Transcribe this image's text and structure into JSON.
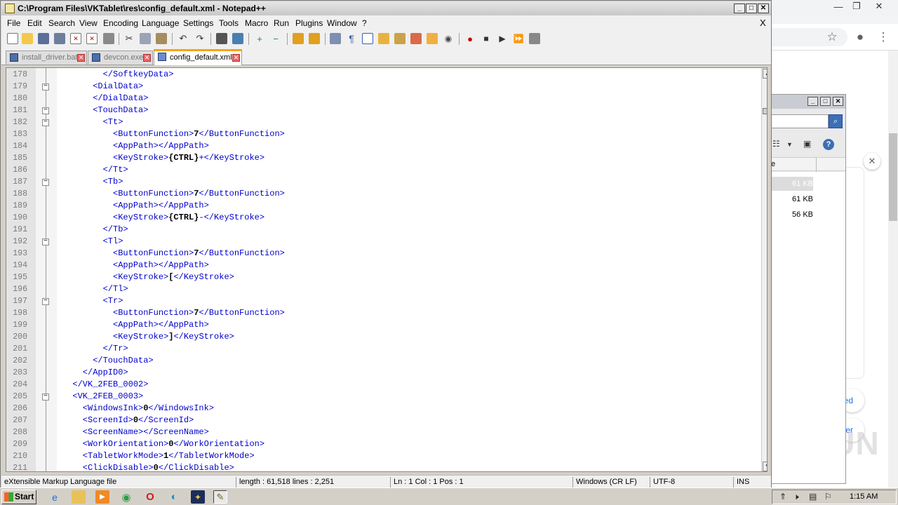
{
  "notepad": {
    "title": "C:\\Program Files\\VKTablet\\res\\config_default.xml - Notepad++",
    "menu": [
      "File",
      "Edit",
      "Search",
      "View",
      "Encoding",
      "Language",
      "Settings",
      "Tools",
      "Macro",
      "Run",
      "Plugins",
      "Window",
      "?"
    ],
    "menu_close": "X",
    "tabs": [
      {
        "label": "install_driver.bat",
        "active": false
      },
      {
        "label": "devcon.exe",
        "active": false
      },
      {
        "label": "config_default.xml",
        "active": true
      }
    ],
    "toolbar_icons": [
      "new-file-icon",
      "open-file-icon",
      "save-icon",
      "save-all-icon",
      "close-icon",
      "close-all-icon",
      "print-icon",
      "cut-icon",
      "copy-icon",
      "paste-icon",
      "undo-icon",
      "redo-icon",
      "find-icon",
      "replace-icon",
      "zoom-in-icon",
      "zoom-out-icon",
      "sync-vertical-icon",
      "sync-horizontal-icon",
      "word-wrap-icon",
      "show-all-chars-icon",
      "indent-guide-icon",
      "udl-icon",
      "doc-map-icon",
      "function-list-icon",
      "folder-workspace-icon",
      "monitor-icon",
      "record-macro-icon",
      "stop-macro-icon",
      "play-macro-icon",
      "run-macro-multiple-icon",
      "save-macro-icon"
    ],
    "lines": [
      {
        "n": "178",
        "fold": "",
        "code": "        </SoftkeyData>"
      },
      {
        "n": "179",
        "fold": "box",
        "code": "      <DialData>"
      },
      {
        "n": "180",
        "fold": "",
        "code": "      </DialData>"
      },
      {
        "n": "181",
        "fold": "box",
        "code": "      <TouchData>"
      },
      {
        "n": "182",
        "fold": "box",
        "code": "        <Tt>"
      },
      {
        "n": "183",
        "fold": "",
        "pre": "          <ButtonFunction>",
        "val": "7",
        "post": "</ButtonFunction>"
      },
      {
        "n": "184",
        "fold": "",
        "code": "          <AppPath></AppPath>"
      },
      {
        "n": "185",
        "fold": "",
        "pre": "          <KeyStroke>",
        "val": "{CTRL}",
        "post": "+</KeyStroke>"
      },
      {
        "n": "186",
        "fold": "",
        "code": "        </Tt>"
      },
      {
        "n": "187",
        "fold": "box",
        "code": "        <Tb>"
      },
      {
        "n": "188",
        "fold": "",
        "pre": "          <ButtonFunction>",
        "val": "7",
        "post": "</ButtonFunction>"
      },
      {
        "n": "189",
        "fold": "",
        "code": "          <AppPath></AppPath>"
      },
      {
        "n": "190",
        "fold": "",
        "pre": "          <KeyStroke>",
        "val": "{CTRL}",
        "post": "-</KeyStroke>"
      },
      {
        "n": "191",
        "fold": "",
        "code": "        </Tb>"
      },
      {
        "n": "192",
        "fold": "box",
        "code": "        <Tl>"
      },
      {
        "n": "193",
        "fold": "",
        "pre": "          <ButtonFunction>",
        "val": "7",
        "post": "</ButtonFunction>"
      },
      {
        "n": "194",
        "fold": "",
        "code": "          <AppPath></AppPath>"
      },
      {
        "n": "195",
        "fold": "",
        "pre": "          <KeyStroke>",
        "val": "[",
        "post": "</KeyStroke>"
      },
      {
        "n": "196",
        "fold": "",
        "code": "        </Tl>"
      },
      {
        "n": "197",
        "fold": "box",
        "code": "        <Tr>"
      },
      {
        "n": "198",
        "fold": "",
        "pre": "          <ButtonFunction>",
        "val": "7",
        "post": "</ButtonFunction>"
      },
      {
        "n": "199",
        "fold": "",
        "code": "          <AppPath></AppPath>"
      },
      {
        "n": "200",
        "fold": "",
        "pre": "          <KeyStroke>",
        "val": "]",
        "post": "</KeyStroke>"
      },
      {
        "n": "201",
        "fold": "",
        "code": "        </Tr>"
      },
      {
        "n": "202",
        "fold": "",
        "code": "      </TouchData>"
      },
      {
        "n": "203",
        "fold": "",
        "code": "    </AppID0>"
      },
      {
        "n": "204",
        "fold": "",
        "code": "  </VK_2FEB_0002>"
      },
      {
        "n": "205",
        "fold": "box",
        "code": "  <VK_2FEB_0003>"
      },
      {
        "n": "206",
        "fold": "",
        "pre": "    <WindowsInk>",
        "val": "0",
        "post": "</WindowsInk>"
      },
      {
        "n": "207",
        "fold": "",
        "pre": "    <ScreenId>",
        "val": "0",
        "post": "</ScreenId>"
      },
      {
        "n": "208",
        "fold": "",
        "code": "    <ScreenName></ScreenName>"
      },
      {
        "n": "209",
        "fold": "",
        "pre": "    <WorkOrientation>",
        "val": "0",
        "post": "</WorkOrientation>"
      },
      {
        "n": "210",
        "fold": "",
        "pre": "    <TabletWorkMode>",
        "val": "1",
        "post": "</TabletWorkMode>"
      },
      {
        "n": "211",
        "fold": "",
        "pre": "    <ClickDisable>",
        "val": "0",
        "post": "</ClickDisable>"
      }
    ],
    "status": {
      "filetype": "eXtensible Markup Language file",
      "length": "length : 61,518    lines : 2,251",
      "position": "Ln : 1    Col : 1    Pos : 1",
      "eol": "Windows (CR LF)",
      "encoding": "UTF-8",
      "mode": "INS"
    }
  },
  "explorer": {
    "col_header": "e",
    "sizes": [
      "61 KB",
      "61 KB",
      "56 KB"
    ]
  },
  "browser": {
    "link1": "ed",
    "link2": "er",
    "watermark": "ANY RUN"
  },
  "taskbar": {
    "start": "Start",
    "clock": "1:15 AM"
  }
}
